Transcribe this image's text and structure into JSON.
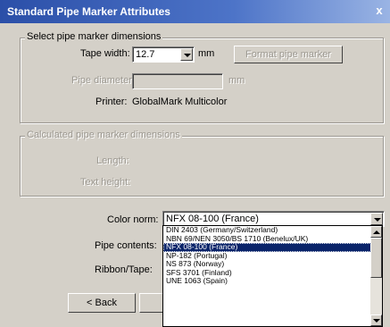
{
  "window": {
    "title": "Standard Pipe Marker Attributes",
    "close_glyph": "x"
  },
  "dimensions": {
    "legend": "Select pipe marker dimensions",
    "tape_width_label": "Tape width:",
    "tape_width_value": "12.7",
    "tape_width_unit": "mm",
    "format_button": "Format pipe marker",
    "pipe_diameter_label": "Pipe diameter:",
    "pipe_diameter_value": "",
    "pipe_diameter_unit": "mm",
    "printer_label": "Printer:",
    "printer_value": "GlobalMark Multicolor"
  },
  "calculated": {
    "legend": "Calculated pipe marker dimensions",
    "length_label": "Length:",
    "text_height_label": "Text height:"
  },
  "color_norm": {
    "label": "Color norm:",
    "selected": "NFX 08-100 (France)",
    "options": [
      "DIN 2403 (Germany/Switzerland)",
      "NBN 69/NEN 3050/BS 1710 (Benelux/UK)",
      "NFX 08-100 (France)",
      "NP-182 (Portugal)",
      "NS 873 (Norway)",
      "SFS 3701 (Finland)",
      "UNE 1063 (Spain)"
    ],
    "selected_index": 2
  },
  "pipe_contents_label": "Pipe contents:",
  "ribbon_label": "Ribbon/Tape:",
  "buttons": {
    "back": "< Back"
  }
}
